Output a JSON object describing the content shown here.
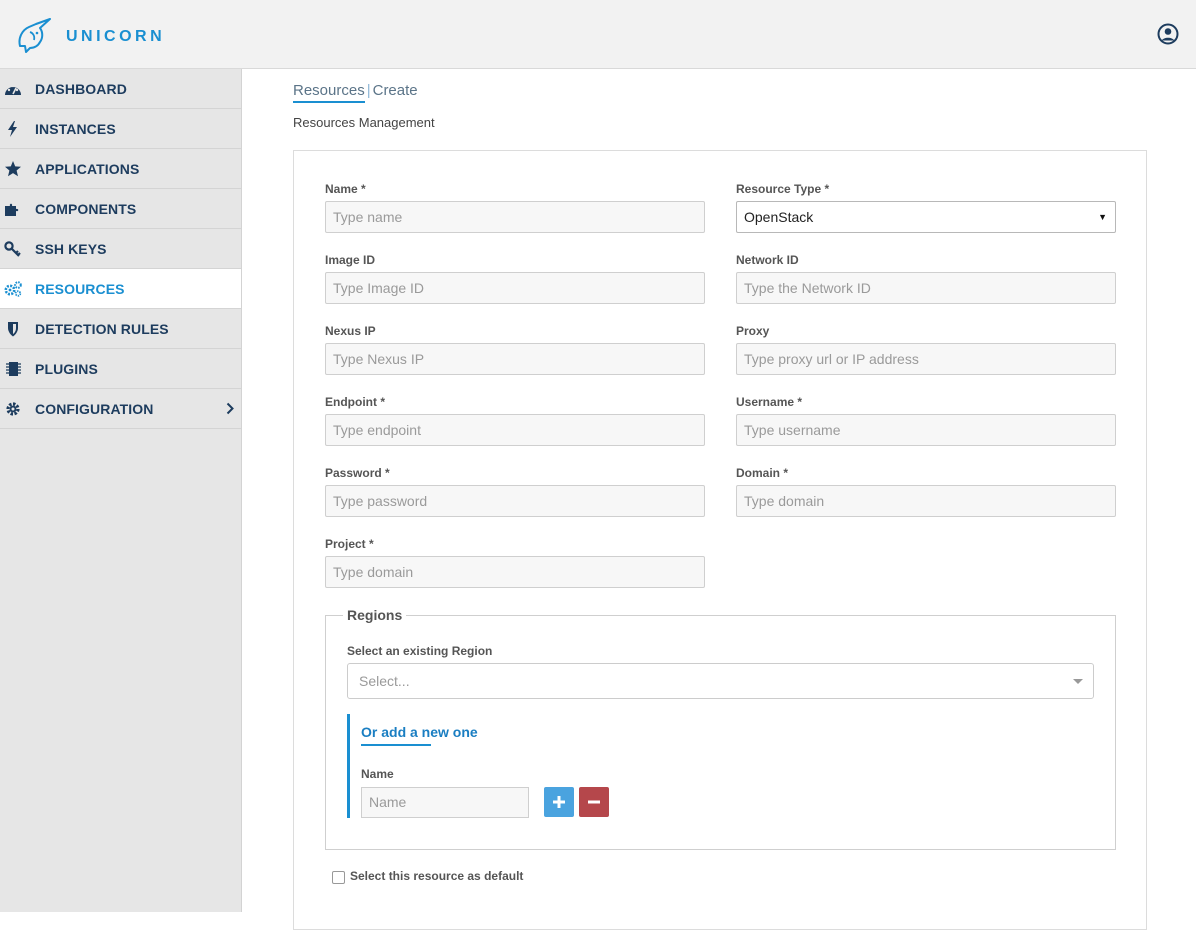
{
  "app": {
    "brand": "UNICORN"
  },
  "colors": {
    "accent": "#1a8fd1",
    "nav_text": "#1d3c5e",
    "add_button": "#4aa3df",
    "remove_button": "#b5474b"
  },
  "sidebar": {
    "items": [
      {
        "label": "DASHBOARD",
        "icon": "dashboard-gauge-icon",
        "active": false
      },
      {
        "label": "INSTANCES",
        "icon": "bolt-icon",
        "active": false
      },
      {
        "label": "APPLICATIONS",
        "icon": "star-icon",
        "active": false
      },
      {
        "label": "COMPONENTS",
        "icon": "puzzle-icon",
        "active": false
      },
      {
        "label": "SSH KEYS",
        "icon": "key-icon",
        "active": false
      },
      {
        "label": "RESOURCES",
        "icon": "cogs-icon",
        "active": true
      },
      {
        "label": "DETECTION RULES",
        "icon": "shield-icon",
        "active": false
      },
      {
        "label": "PLUGINS",
        "icon": "chip-icon",
        "active": false
      },
      {
        "label": "CONFIGURATION",
        "icon": "gear-icon",
        "active": false,
        "has_submenu": true
      }
    ]
  },
  "tabs": {
    "resources": "Resources",
    "separator": "|",
    "create": "Create"
  },
  "subtitle": "Resources Management",
  "form": {
    "name": {
      "label": "Name *",
      "placeholder": "Type name"
    },
    "resource_type": {
      "label": "Resource Type *",
      "value": "OpenStack"
    },
    "image_id": {
      "label": "Image ID",
      "placeholder": "Type Image ID"
    },
    "network_id": {
      "label": "Network ID",
      "placeholder": "Type the Network ID"
    },
    "nexus_ip": {
      "label": "Nexus IP",
      "placeholder": "Type Nexus IP"
    },
    "proxy": {
      "label": "Proxy",
      "placeholder": "Type proxy url or IP address"
    },
    "endpoint": {
      "label": "Endpoint *",
      "placeholder": "Type endpoint"
    },
    "username": {
      "label": "Username *",
      "placeholder": "Type username"
    },
    "password": {
      "label": "Password *",
      "placeholder": "Type password"
    },
    "domain": {
      "label": "Domain *",
      "placeholder": "Type domain"
    },
    "project": {
      "label": "Project *",
      "placeholder": "Type domain"
    },
    "regions": {
      "legend": "Regions",
      "select_label": "Select an existing Region",
      "select_placeholder": "Select...",
      "add_new_title": "Or add a new one",
      "name_label": "Name",
      "name_placeholder": "Name",
      "add_button": "+",
      "remove_button": "−"
    },
    "default_checkbox": {
      "label": "Select this resource as default",
      "checked": false
    }
  }
}
